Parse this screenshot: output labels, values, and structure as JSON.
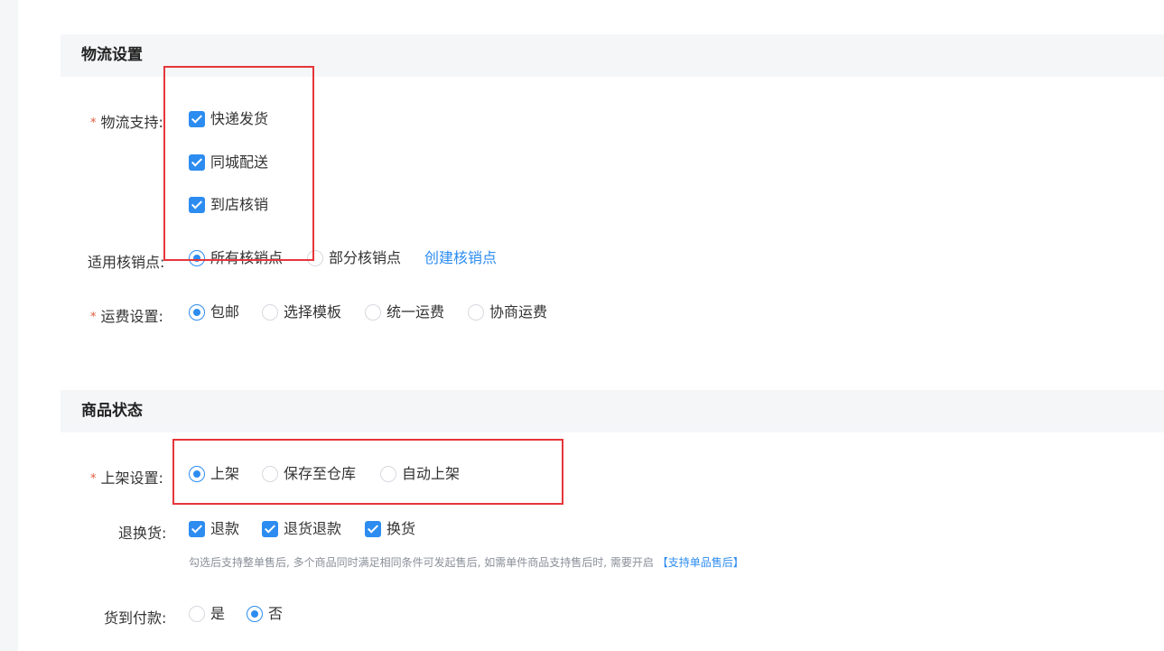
{
  "logistics": {
    "title": "物流设置",
    "support": {
      "label": "物流支持:",
      "options": [
        "快递发货",
        "同城配送",
        "到店核销"
      ]
    },
    "pickup_points": {
      "label": "适用核销点:",
      "options": [
        "所有核销点",
        "部分核销点"
      ],
      "selected": "所有核销点",
      "create_link": "创建核销点"
    },
    "shipping_fee": {
      "label": "运费设置:",
      "options": [
        "包邮",
        "选择模板",
        "统一运费",
        "协商运费"
      ],
      "selected": "包邮"
    }
  },
  "product_status": {
    "title": "商品状态",
    "listing": {
      "label": "上架设置:",
      "options": [
        "上架",
        "保存至仓库",
        "自动上架"
      ],
      "selected": "上架"
    },
    "returns": {
      "label": "退换货:",
      "options": [
        "退款",
        "退货退款",
        "换货"
      ],
      "hint": "勾选后支持整单售后, 多个商品同时满足相同条件可发起售后, 如需单件商品支持售后时, 需要开启",
      "hint_link": "【支持单品售后】"
    },
    "cod": {
      "label": "货到付款:",
      "options": [
        "是",
        "否"
      ],
      "selected": "否"
    }
  },
  "colors": {
    "accent": "#2d8cf0",
    "required": "#e05a3b",
    "highlight": "#e5363a",
    "section_bg": "#f5f6f8"
  }
}
